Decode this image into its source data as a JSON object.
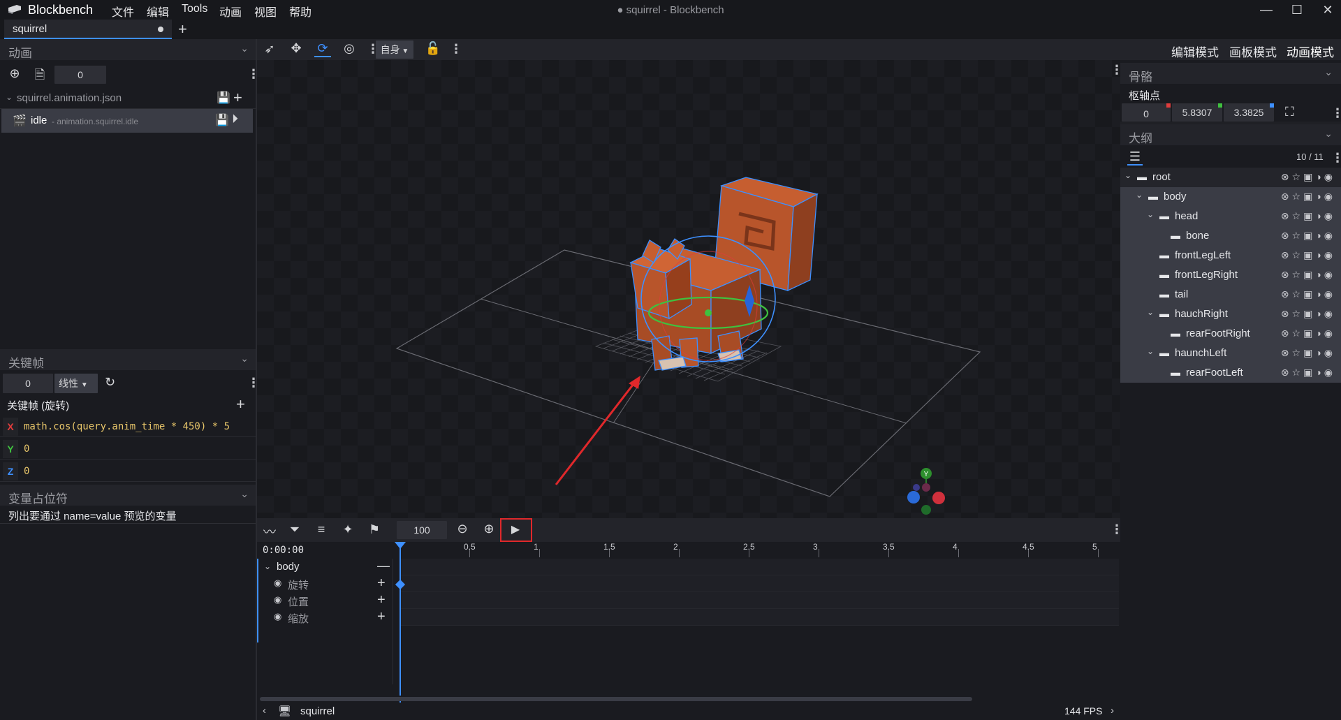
{
  "app": {
    "brand": "Blockbench",
    "window_title": "● squirrel - Blockbench",
    "menu": [
      "文件",
      "编辑",
      "Tools",
      "动画",
      "视图",
      "帮助"
    ]
  },
  "tabs": [
    {
      "label": "squirrel"
    }
  ],
  "animation_panel": {
    "title": "动画",
    "time_value": "0",
    "file_name": "squirrel.animation.json",
    "animation_name": "idle",
    "animation_id": " - animation.squirrel.idle"
  },
  "toolbar": {
    "transform_space": "自身",
    "modes": [
      "编辑模式",
      "画板模式",
      "动画模式"
    ]
  },
  "keyframe_panel": {
    "title": "关键帧",
    "time_value": "0",
    "interpolation": "线性",
    "keyframe_label": "关键帧 (旋转)",
    "axes": [
      {
        "axis": "X",
        "value": "math.cos(query.anim_time * 450) * 5",
        "color": "#e03c3c"
      },
      {
        "axis": "Y",
        "value": "0",
        "color": "#3fc13f"
      },
      {
        "axis": "Z",
        "value": "0",
        "color": "#3e90ff"
      }
    ]
  },
  "variables_panel": {
    "title": "变量占位符",
    "text": "列出要通过 name=value 预览的变量"
  },
  "bone_panel": {
    "title": "骨骼",
    "pivot_label": "枢轴点",
    "pivot": [
      "0",
      "5.8307",
      "3.3825"
    ]
  },
  "outliner": {
    "title": "大纲",
    "count": "10 / 11",
    "items": [
      {
        "name": "root",
        "depth": 0,
        "expanded": true,
        "selected": false
      },
      {
        "name": "body",
        "depth": 1,
        "expanded": true,
        "selected": true
      },
      {
        "name": "head",
        "depth": 2,
        "expanded": true,
        "selected": true
      },
      {
        "name": "bone",
        "depth": 3,
        "expanded": false,
        "selected": true
      },
      {
        "name": "frontLegLeft",
        "depth": 2,
        "expanded": false,
        "selected": true
      },
      {
        "name": "frontLegRight",
        "depth": 2,
        "expanded": false,
        "selected": true
      },
      {
        "name": "tail",
        "depth": 2,
        "expanded": false,
        "selected": true
      },
      {
        "name": "hauchRight",
        "depth": 2,
        "expanded": true,
        "selected": true
      },
      {
        "name": "rearFootRight",
        "depth": 3,
        "expanded": false,
        "selected": true
      },
      {
        "name": "haunchLeft",
        "depth": 2,
        "expanded": true,
        "selected": true
      },
      {
        "name": "rearFootLeft",
        "depth": 3,
        "expanded": false,
        "selected": true
      }
    ]
  },
  "timeline": {
    "fps_input": "100",
    "timecode": "0:00:00",
    "ruler": [
      "0.5",
      "1",
      "1.5",
      "2",
      "2.5",
      "3",
      "3.5",
      "4",
      "4.5",
      "5"
    ],
    "tracks": {
      "group": "body",
      "channels": [
        "旋转",
        "位置",
        "缩放"
      ]
    }
  },
  "statusbar": {
    "model": "squirrel",
    "fps": "144 FPS"
  },
  "colors": {
    "accent": "#3e90ff",
    "highlight_box": "#e0282b",
    "model": "#b8552b"
  }
}
